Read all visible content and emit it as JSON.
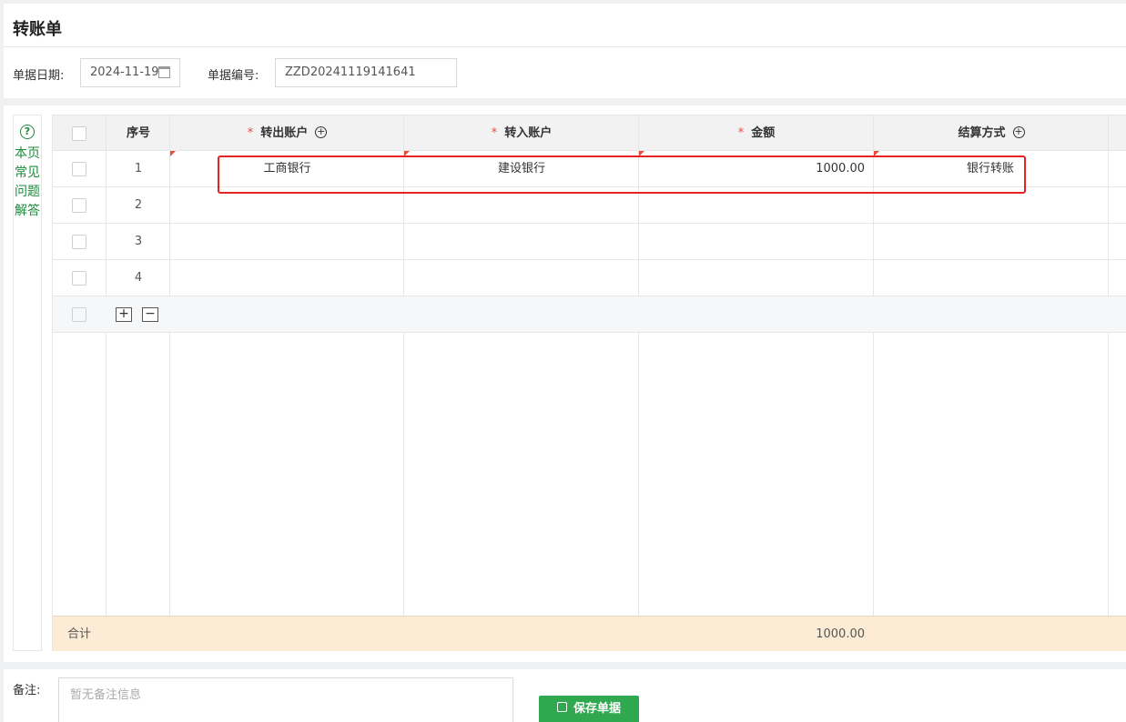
{
  "header": {
    "title": "转账单",
    "date_label": "单据日期:",
    "date_value": "2024-11-19",
    "code_label": "单据编号:",
    "code_value": "ZZD20241119141641"
  },
  "faq": {
    "icon": "question-circle-icon",
    "label": "本页常见问题解答"
  },
  "table": {
    "columns": [
      "序号",
      "转出账户",
      "转入账户",
      "金额",
      "结算方式"
    ],
    "required_mark": "*",
    "rows": [
      {
        "no": "1",
        "from": "工商银行",
        "to": "建设银行",
        "amount": "1000.00",
        "method": "银行转账"
      },
      {
        "no": "2",
        "from": "",
        "to": "",
        "amount": "",
        "method": ""
      },
      {
        "no": "3",
        "from": "",
        "to": "",
        "amount": "",
        "method": ""
      },
      {
        "no": "4",
        "from": "",
        "to": "",
        "amount": "",
        "method": ""
      }
    ],
    "add_row": "+",
    "remove_row": "−",
    "sum_label": "合计",
    "sum_amount": "1000.00"
  },
  "footer": {
    "remark_label": "备注:",
    "remark_placeholder": "暂无备注信息",
    "save_label": "保存单据"
  },
  "colors": {
    "accent": "#2fa84f",
    "faq_green": "#1e8a3c",
    "required_red": "#e84c3d",
    "sum_bg": "#fcecd6",
    "highlight_red": "#e62222"
  }
}
